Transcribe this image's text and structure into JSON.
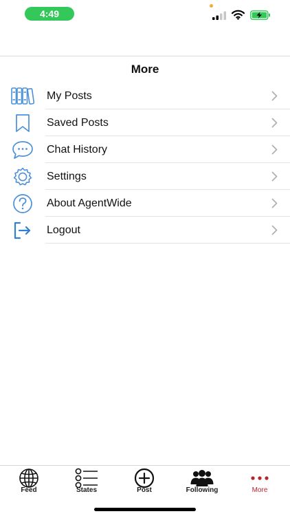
{
  "status_bar": {
    "time": "4:49"
  },
  "header": {
    "title": "More"
  },
  "menu": {
    "items": [
      {
        "label": "My Posts",
        "icon": "books-icon"
      },
      {
        "label": "Saved Posts",
        "icon": "bookmark-icon"
      },
      {
        "label": "Chat History",
        "icon": "chat-bubble-icon"
      },
      {
        "label": "Settings",
        "icon": "gear-icon"
      },
      {
        "label": "About AgentWide",
        "icon": "question-circle-icon"
      },
      {
        "label": "Logout",
        "icon": "logout-icon"
      }
    ]
  },
  "tab_bar": {
    "tabs": [
      {
        "label": "Feed",
        "icon": "globe-icon"
      },
      {
        "label": "States",
        "icon": "list-icon"
      },
      {
        "label": "Post",
        "icon": "plus-circle-icon"
      },
      {
        "label": "Following",
        "icon": "people-icon"
      },
      {
        "label": "More",
        "icon": "more-dots-icon",
        "active": true
      }
    ]
  },
  "colors": {
    "accent_icon": "#4a90d9",
    "active_tab": "#b3262c",
    "status_pill": "#34c759"
  }
}
